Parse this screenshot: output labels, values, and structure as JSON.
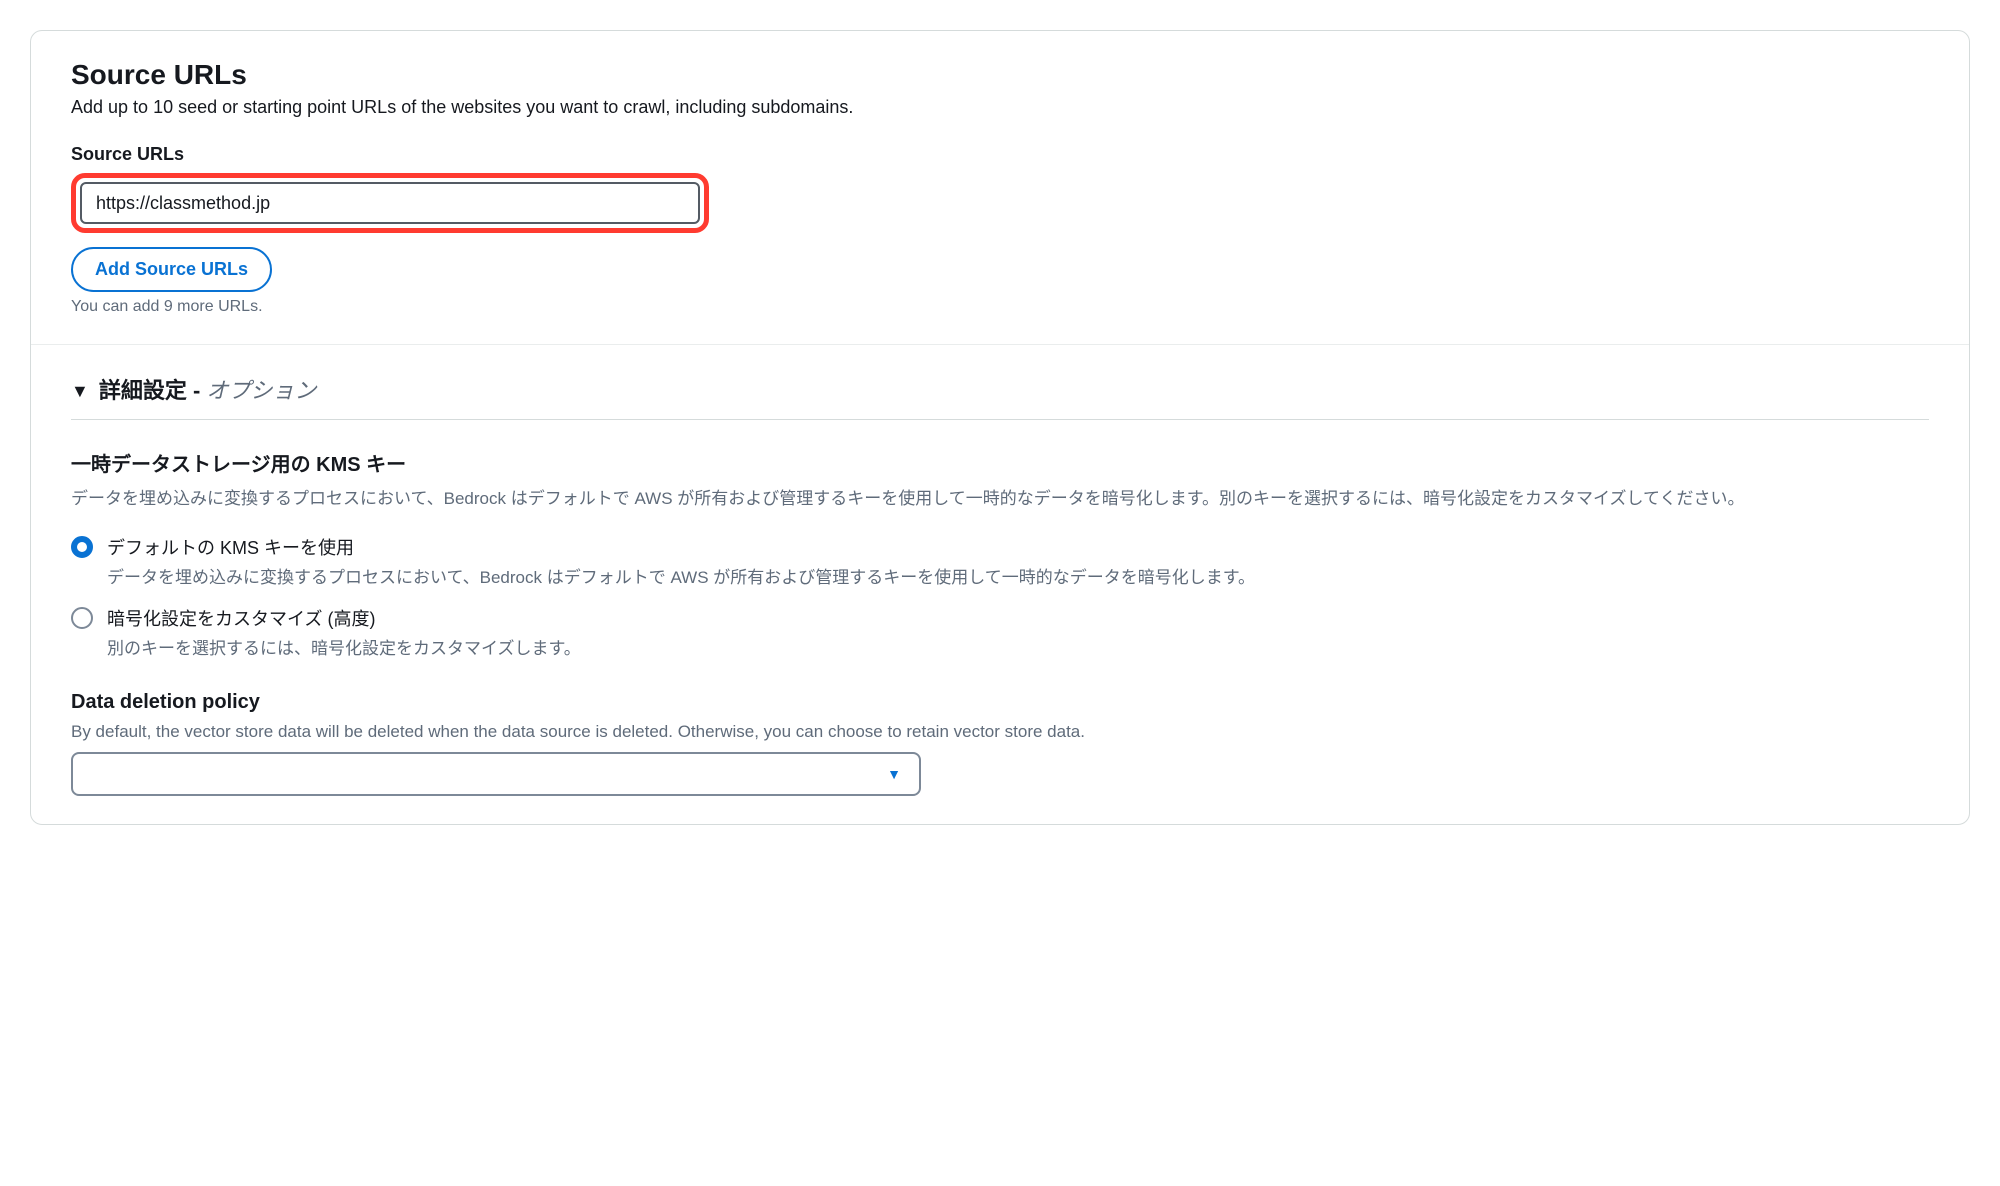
{
  "sourceUrls": {
    "title": "Source URLs",
    "description": "Add up to 10 seed or starting point URLs of the websites you want to crawl, including subdomains.",
    "fieldLabel": "Source URLs",
    "inputValue": "https://classmethod.jp",
    "addButtonLabel": "Add Source URLs",
    "helperText": "You can add 9 more URLs."
  },
  "advanced": {
    "headerPrefix": "詳細設定 - ",
    "headerSuffix": "オプション",
    "kms": {
      "heading": "一時データストレージ用の KMS キー",
      "description": "データを埋め込みに変換するプロセスにおいて、Bedrock はデフォルトで AWS が所有および管理するキーを使用して一時的なデータを暗号化します。別のキーを選択するには、暗号化設定をカスタマイズしてください。",
      "options": [
        {
          "label": "デフォルトの KMS キーを使用",
          "description": "データを埋め込みに変換するプロセスにおいて、Bedrock はデフォルトで AWS が所有および管理するキーを使用して一時的なデータを暗号化します。",
          "selected": true
        },
        {
          "label": "暗号化設定をカスタマイズ (高度)",
          "description": "別のキーを選択するには、暗号化設定をカスタマイズします。",
          "selected": false
        }
      ]
    },
    "deletion": {
      "heading": "Data deletion policy",
      "description": "By default, the vector store data will be deleted when the data source is deleted. Otherwise, you can choose to retain vector store data.",
      "selectValue": ""
    }
  }
}
